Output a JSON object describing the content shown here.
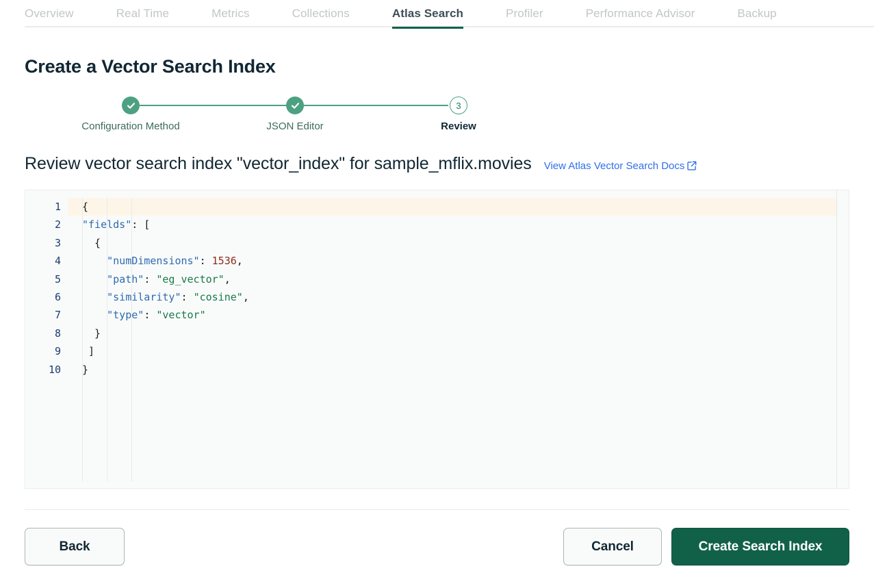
{
  "tabs": [
    {
      "label": "Overview",
      "active": false
    },
    {
      "label": "Real Time",
      "active": false
    },
    {
      "label": "Metrics",
      "active": false
    },
    {
      "label": "Collections",
      "active": false
    },
    {
      "label": "Atlas Search",
      "active": true
    },
    {
      "label": "Profiler",
      "active": false
    },
    {
      "label": "Performance Advisor",
      "active": false
    },
    {
      "label": "Backup",
      "active": false
    }
  ],
  "page": {
    "title": "Create a Vector Search Index",
    "review_title": "Review vector search index \"vector_index\" for sample_mflix.movies",
    "docs_link": "View Atlas Vector Search Docs"
  },
  "stepper": {
    "steps": [
      {
        "label": "Configuration Method",
        "state": "done",
        "number": "1"
      },
      {
        "label": "JSON Editor",
        "state": "done",
        "number": "2"
      },
      {
        "label": "Review",
        "state": "current",
        "number": "3"
      }
    ]
  },
  "editor": {
    "highlighted_line": 1,
    "line_numbers": [
      "1",
      "2",
      "3",
      "4",
      "5",
      "6",
      "7",
      "8",
      "9",
      "10"
    ],
    "lines": [
      [
        {
          "t": "punct",
          "v": "{"
        }
      ],
      [
        {
          "t": "key",
          "v": "\"fields\""
        },
        {
          "t": "punct",
          "v": ": ["
        }
      ],
      [
        {
          "t": "punct",
          "v": "  {"
        }
      ],
      [
        {
          "t": "key",
          "v": "    \"numDimensions\""
        },
        {
          "t": "punct",
          "v": ": "
        },
        {
          "t": "num",
          "v": "1536"
        },
        {
          "t": "punct",
          "v": ","
        }
      ],
      [
        {
          "t": "key",
          "v": "    \"path\""
        },
        {
          "t": "punct",
          "v": ": "
        },
        {
          "t": "str",
          "v": "\"eg_vector\""
        },
        {
          "t": "punct",
          "v": ","
        }
      ],
      [
        {
          "t": "key",
          "v": "    \"similarity\""
        },
        {
          "t": "punct",
          "v": ": "
        },
        {
          "t": "str",
          "v": "\"cosine\""
        },
        {
          "t": "punct",
          "v": ","
        }
      ],
      [
        {
          "t": "key",
          "v": "    \"type\""
        },
        {
          "t": "punct",
          "v": ": "
        },
        {
          "t": "str",
          "v": "\"vector\""
        }
      ],
      [
        {
          "t": "punct",
          "v": "  }"
        }
      ],
      [
        {
          "t": "punct",
          "v": " ]"
        }
      ],
      [
        {
          "t": "punct",
          "v": "}"
        }
      ]
    ],
    "raw_json": "{\n\"fields\": [\n  {\n    \"numDimensions\": 1536,\n    \"path\": \"eg_vector\",\n    \"similarity\": \"cosine\",\n    \"type\": \"vector\"\n  }\n ]\n}"
  },
  "footer": {
    "back_label": "Back",
    "cancel_label": "Cancel",
    "create_label": "Create Search Index"
  },
  "colors": {
    "brand_green": "#116149",
    "step_green": "#4ba181",
    "link_blue": "#2f6eea",
    "title_navy": "#112733",
    "tab_inactive": "#c1c7c6",
    "highlight_line": "#fdf6e8"
  }
}
